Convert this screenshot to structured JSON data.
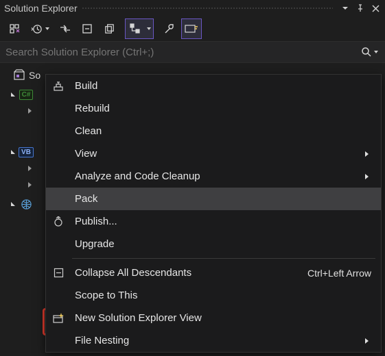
{
  "panel_title": "Solution Explorer",
  "search": {
    "placeholder": "Search Solution Explorer (Ctrl+;)"
  },
  "tree": {
    "solution_label": "So",
    "csharp_chip": "C#",
    "vb_chip": "VB"
  },
  "context_menu": {
    "items": [
      {
        "label": "Build",
        "icon": "build-icon",
        "submenu": false
      },
      {
        "label": "Rebuild",
        "icon": null,
        "submenu": false
      },
      {
        "label": "Clean",
        "icon": null,
        "submenu": false
      },
      {
        "label": "View",
        "icon": null,
        "submenu": true
      },
      {
        "label": "Analyze and Code Cleanup",
        "icon": null,
        "submenu": true
      },
      {
        "label": "Pack",
        "icon": null,
        "submenu": false,
        "hover": true
      },
      {
        "label": "Publish...",
        "icon": "publish-icon",
        "submenu": false
      },
      {
        "label": "Upgrade",
        "icon": null,
        "submenu": false
      },
      {
        "sep": true
      },
      {
        "label": "Collapse All Descendants",
        "icon": "collapse-icon",
        "submenu": false,
        "shortcut": "Ctrl+Left Arrow"
      },
      {
        "label": "Scope to This",
        "icon": null,
        "submenu": false
      },
      {
        "label": "New Solution Explorer View",
        "icon": "new-view-icon",
        "submenu": false,
        "highlight": true
      },
      {
        "label": "File Nesting",
        "icon": null,
        "submenu": true
      }
    ]
  }
}
